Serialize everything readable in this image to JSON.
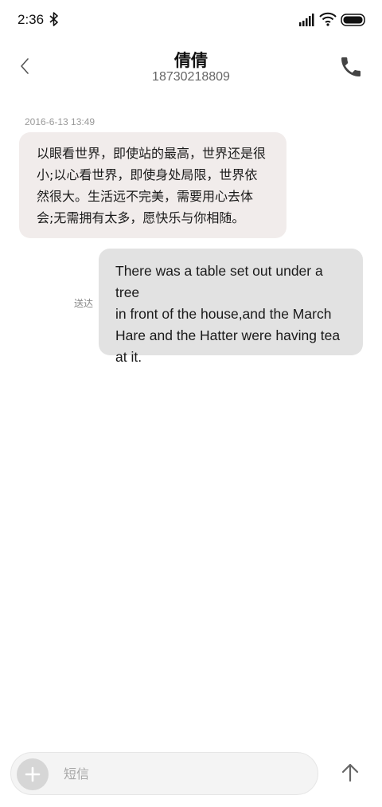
{
  "status_bar": {
    "time": "2:36",
    "icons": [
      "bluetooth-icon",
      "signal-icon",
      "wifi-icon",
      "battery-icon"
    ]
  },
  "header": {
    "contact_name": "倩倩",
    "contact_number": "18730218809",
    "back_icon": "chevron-left-icon",
    "call_icon": "phone-icon"
  },
  "conversation": {
    "timestamp": "2016-6-13 13:49",
    "messages": [
      {
        "direction": "incoming",
        "lines": [
          "以眼看世界，即使站的最高，世界还是很",
          "小;以心看世界，即使身处局限，世界依",
          "然很大。生活远不完美，需要用心去体",
          "会;无需拥有太多，愿快乐与你相随。"
        ]
      },
      {
        "direction": "outgoing",
        "status": "送达",
        "lines": [
          "There was a table set out under a tree",
          "in front of the house,and the March",
          "Hare and the Hatter were having tea",
          "at it."
        ]
      }
    ]
  },
  "compose": {
    "placeholder": "短信",
    "value": "",
    "add_icon": "plus-icon",
    "send_icon": "arrow-up-icon"
  },
  "colors": {
    "incoming_bubble": "#f1eceb",
    "outgoing_bubble": "#e2e2e2",
    "background": "#ffffff"
  }
}
